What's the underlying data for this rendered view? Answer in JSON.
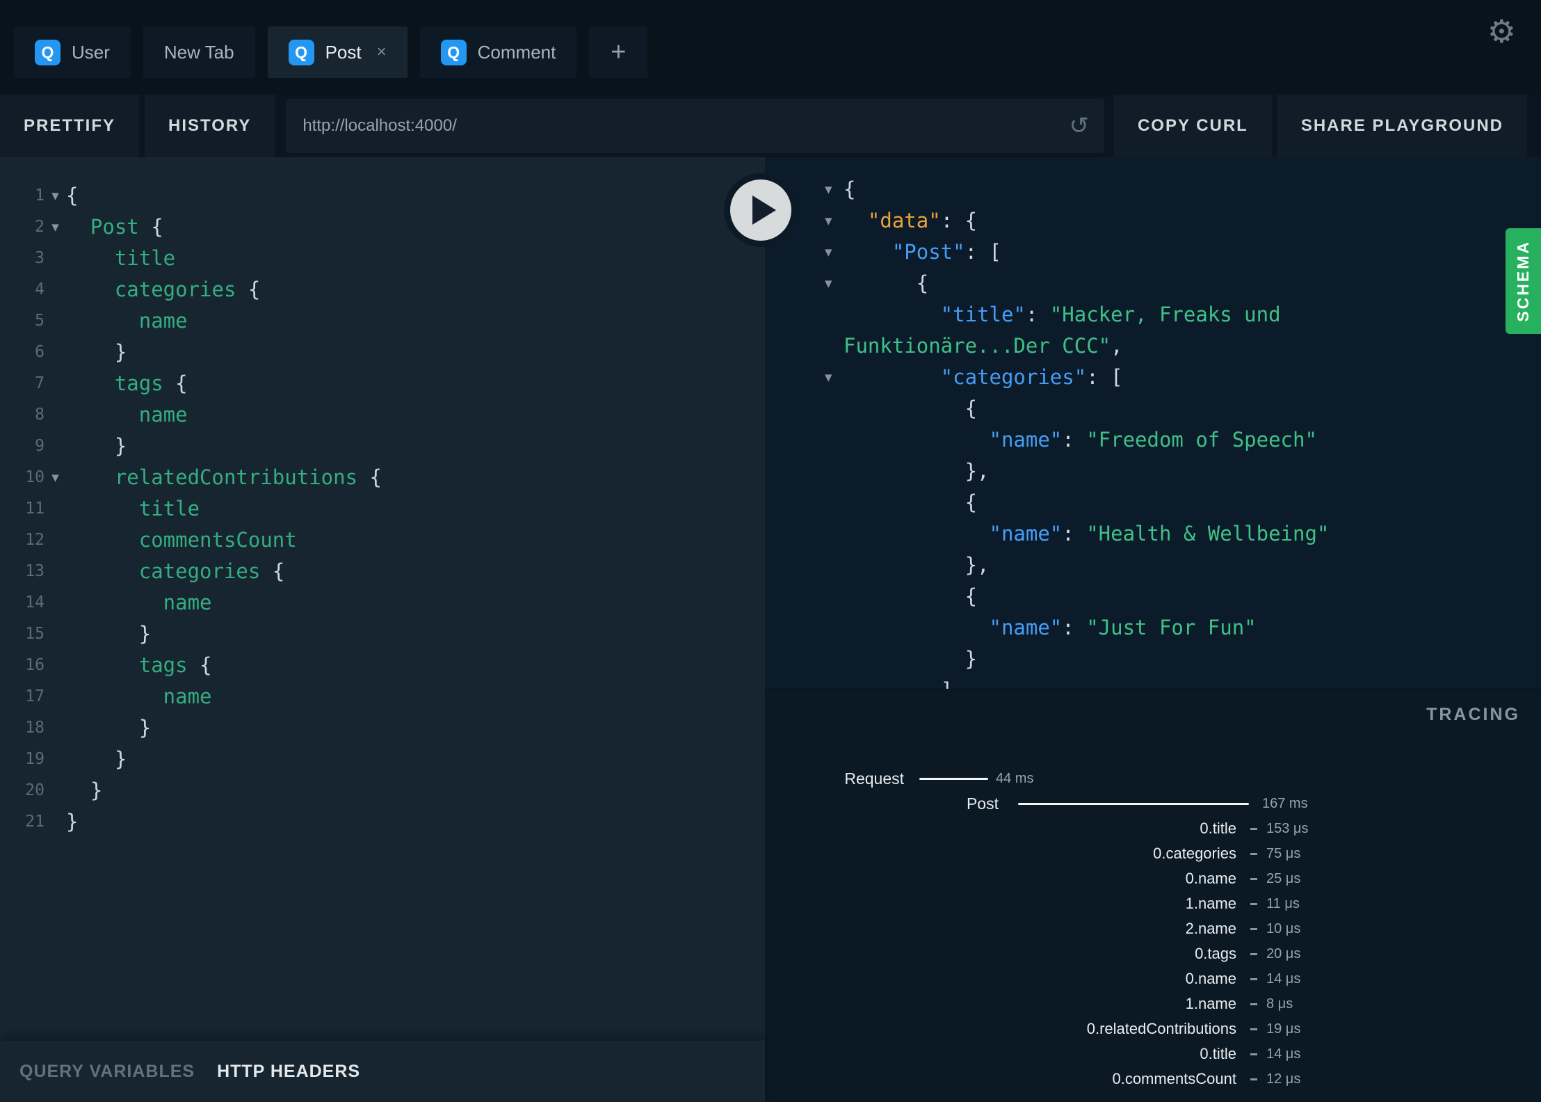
{
  "icons": {
    "q": "Q",
    "close": "×",
    "plus": "+",
    "gear": "⚙",
    "reload": "↺",
    "fold": "▾"
  },
  "tabs": [
    {
      "label": "User",
      "q": true,
      "active": false,
      "closable": false
    },
    {
      "label": "New Tab",
      "q": false,
      "active": false,
      "closable": false
    },
    {
      "label": "Post",
      "q": true,
      "active": true,
      "closable": true
    },
    {
      "label": "Comment",
      "q": true,
      "active": false,
      "closable": false
    }
  ],
  "toolbar": {
    "prettify": "PRETTIFY",
    "history": "HISTORY",
    "url": "http://localhost:4000/",
    "copy_curl": "COPY CURL",
    "share": "SHARE PLAYGROUND"
  },
  "editor": {
    "lines": [
      {
        "n": "1",
        "fold": true,
        "seg": [
          [
            "p",
            "{"
          ]
        ]
      },
      {
        "n": "2",
        "fold": true,
        "seg": [
          [
            "f",
            "  Post "
          ],
          [
            "p",
            "{"
          ]
        ]
      },
      {
        "n": "3",
        "fold": false,
        "seg": [
          [
            "f",
            "    title"
          ]
        ]
      },
      {
        "n": "4",
        "fold": false,
        "seg": [
          [
            "f",
            "    categories "
          ],
          [
            "p",
            "{"
          ]
        ]
      },
      {
        "n": "5",
        "fold": false,
        "seg": [
          [
            "f",
            "      name"
          ]
        ]
      },
      {
        "n": "6",
        "fold": false,
        "seg": [
          [
            "p",
            "    }"
          ]
        ]
      },
      {
        "n": "7",
        "fold": false,
        "seg": [
          [
            "f",
            "    tags "
          ],
          [
            "p",
            "{"
          ]
        ]
      },
      {
        "n": "8",
        "fold": false,
        "seg": [
          [
            "f",
            "      name"
          ]
        ]
      },
      {
        "n": "9",
        "fold": false,
        "seg": [
          [
            "p",
            "    }"
          ]
        ]
      },
      {
        "n": "10",
        "fold": true,
        "seg": [
          [
            "f",
            "    relatedContributions "
          ],
          [
            "p",
            "{"
          ]
        ]
      },
      {
        "n": "11",
        "fold": false,
        "seg": [
          [
            "f",
            "      title"
          ]
        ]
      },
      {
        "n": "12",
        "fold": false,
        "seg": [
          [
            "f",
            "      commentsCount"
          ]
        ]
      },
      {
        "n": "13",
        "fold": false,
        "seg": [
          [
            "f",
            "      categories "
          ],
          [
            "p",
            "{"
          ]
        ]
      },
      {
        "n": "14",
        "fold": false,
        "seg": [
          [
            "f",
            "        name"
          ]
        ]
      },
      {
        "n": "15",
        "fold": false,
        "seg": [
          [
            "p",
            "      }"
          ]
        ]
      },
      {
        "n": "16",
        "fold": false,
        "seg": [
          [
            "f",
            "      tags "
          ],
          [
            "p",
            "{"
          ]
        ]
      },
      {
        "n": "17",
        "fold": false,
        "seg": [
          [
            "f",
            "        name"
          ]
        ]
      },
      {
        "n": "18",
        "fold": false,
        "seg": [
          [
            "p",
            "      }"
          ]
        ]
      },
      {
        "n": "19",
        "fold": false,
        "seg": [
          [
            "p",
            "    }"
          ]
        ]
      },
      {
        "n": "20",
        "fold": false,
        "seg": [
          [
            "p",
            "  }"
          ]
        ]
      },
      {
        "n": "21",
        "fold": false,
        "seg": [
          [
            "p",
            "}"
          ]
        ]
      }
    ]
  },
  "response": {
    "lines": [
      {
        "fold": true,
        "seg": [
          [
            "p",
            "{"
          ]
        ]
      },
      {
        "fold": true,
        "seg": [
          [
            "d",
            "  \"data\""
          ],
          [
            "p",
            ": {"
          ]
        ]
      },
      {
        "fold": true,
        "seg": [
          [
            "k",
            "    \"Post\""
          ],
          [
            "p",
            ": ["
          ]
        ]
      },
      {
        "fold": true,
        "seg": [
          [
            "p",
            "      {"
          ]
        ]
      },
      {
        "fold": false,
        "seg": [
          [
            "k",
            "        \"title\""
          ],
          [
            "p",
            ": "
          ],
          [
            "s",
            "\"Hacker, Freaks und"
          ]
        ]
      },
      {
        "fold": false,
        "seg": [
          [
            "s",
            "Funktionäre...Der CCC\""
          ],
          [
            "p",
            ","
          ]
        ]
      },
      {
        "fold": true,
        "seg": [
          [
            "k",
            "        \"categories\""
          ],
          [
            "p",
            ": ["
          ]
        ]
      },
      {
        "fold": false,
        "seg": [
          [
            "p",
            "          {"
          ]
        ]
      },
      {
        "fold": false,
        "seg": [
          [
            "k",
            "            \"name\""
          ],
          [
            "p",
            ": "
          ],
          [
            "s",
            "\"Freedom of Speech\""
          ]
        ]
      },
      {
        "fold": false,
        "seg": [
          [
            "p",
            "          },"
          ]
        ]
      },
      {
        "fold": false,
        "seg": [
          [
            "p",
            "          {"
          ]
        ]
      },
      {
        "fold": false,
        "seg": [
          [
            "k",
            "            \"name\""
          ],
          [
            "p",
            ": "
          ],
          [
            "s",
            "\"Health & Wellbeing\""
          ]
        ]
      },
      {
        "fold": false,
        "seg": [
          [
            "p",
            "          },"
          ]
        ]
      },
      {
        "fold": false,
        "seg": [
          [
            "p",
            "          {"
          ]
        ]
      },
      {
        "fold": false,
        "seg": [
          [
            "k",
            "            \"name\""
          ],
          [
            "p",
            ": "
          ],
          [
            "s",
            "\"Just For Fun\""
          ]
        ]
      },
      {
        "fold": false,
        "seg": [
          [
            "p",
            "          }"
          ]
        ]
      },
      {
        "fold": false,
        "seg": [
          [
            "p",
            "        ]"
          ]
        ]
      }
    ]
  },
  "schema_tab": {
    "label": "SCHEMA"
  },
  "tracing": {
    "title": "TRACING",
    "rows": [
      {
        "type": "request",
        "label": "Request",
        "value": "44 ms"
      },
      {
        "type": "post",
        "label": "Post",
        "value": "167 ms"
      },
      {
        "type": "detail",
        "label": "0.title",
        "value": "153 μs"
      },
      {
        "type": "detail",
        "label": "0.categories",
        "value": "75 μs"
      },
      {
        "type": "detail",
        "label": "0.name",
        "value": "25 μs"
      },
      {
        "type": "detail",
        "label": "1.name",
        "value": "11 μs"
      },
      {
        "type": "detail",
        "label": "2.name",
        "value": "10 μs"
      },
      {
        "type": "detail",
        "label": "0.tags",
        "value": "20 μs"
      },
      {
        "type": "detail",
        "label": "0.name",
        "value": "14 μs"
      },
      {
        "type": "detail",
        "label": "1.name",
        "value": "8 μs"
      },
      {
        "type": "detail",
        "label": "0.relatedContributions",
        "value": "19 μs"
      },
      {
        "type": "detail",
        "label": "0.title",
        "value": "14 μs"
      },
      {
        "type": "detail",
        "label": "0.commentsCount",
        "value": "12 μs"
      }
    ]
  },
  "bottom": {
    "query_variables": "QUERY VARIABLES",
    "http_headers": "HTTP HEADERS"
  },
  "colors": {
    "accent_blue": "#2497f3",
    "key_blue": "#459df5",
    "field_green": "#35ad81",
    "string_green": "#3fc088",
    "data_orange": "#e8a33c",
    "schema_green": "#27b05e",
    "editor_bg": "#172530",
    "response_bg": "#0c1b29",
    "topbar_bg": "#09131c"
  }
}
